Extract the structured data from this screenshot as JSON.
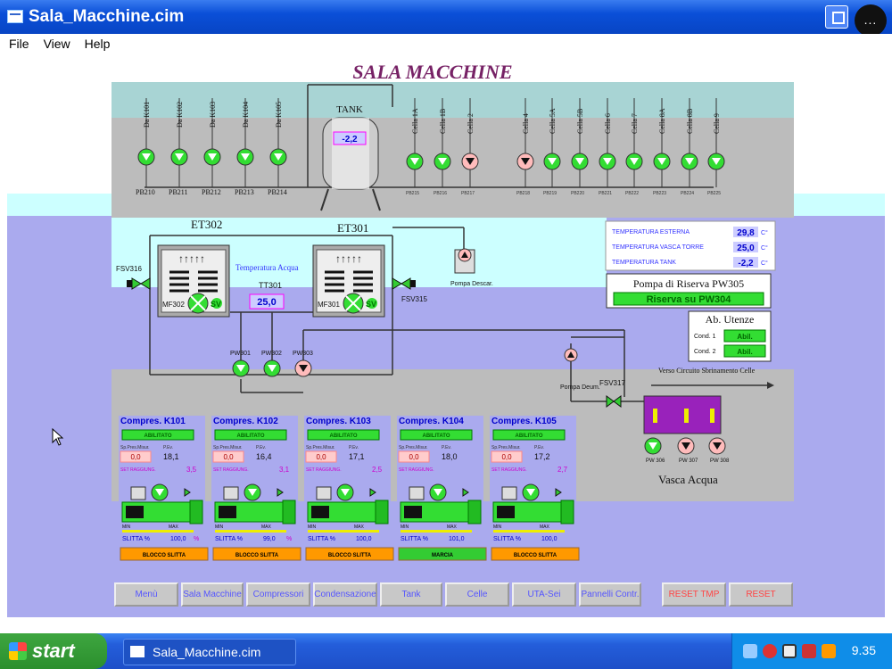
{
  "window": {
    "title": "Sala_Macchine.cim",
    "circle_btn": "..."
  },
  "menu": [
    "File",
    "View",
    "Help"
  ],
  "scada": {
    "title": "SALA MACCHINE",
    "tank": {
      "label": "TANK",
      "value": "-2,2"
    },
    "top_pumps": [
      {
        "label": "Da K101",
        "id": "PB210"
      },
      {
        "label": "Da K102",
        "id": "PB211"
      },
      {
        "label": "Da K103",
        "id": "PB212"
      },
      {
        "label": "Da K104",
        "id": "PB213"
      },
      {
        "label": "Da K105",
        "id": "PB214"
      }
    ],
    "cells": [
      {
        "label": "Cella 1A",
        "state": "on"
      },
      {
        "label": "Cella 1B",
        "state": "on"
      },
      {
        "label": "Cella 2",
        "state": "off"
      },
      {
        "label": "Cella 4",
        "state": "off"
      },
      {
        "label": "Cella 5A",
        "state": "on"
      },
      {
        "label": "Cella 5B",
        "state": "on"
      },
      {
        "label": "Cella 6",
        "state": "on"
      },
      {
        "label": "Cella 7",
        "state": "on"
      },
      {
        "label": "Cella 8A",
        "state": "on"
      },
      {
        "label": "Cella 8B",
        "state": "on"
      },
      {
        "label": "Cella 9",
        "state": "on"
      }
    ],
    "cell_ids": [
      "PB215",
      "PB216",
      "PB217",
      "PB218",
      "PB219",
      "PB220",
      "PB221",
      "PB222",
      "PB223",
      "PB224",
      "PB225"
    ],
    "et302": "ET302",
    "et301": "ET301",
    "mf302": "MF302",
    "mf301": "MF301",
    "sv": "SV",
    "fsv316": "FSV316",
    "fsv315": "FSV315",
    "fsv317": "FSV317",
    "temp_acqua_label": "Temperatura Acqua",
    "tt301": "TT301",
    "tt301_value": "25,0",
    "pompa_descar": "Pompa Descar.",
    "pompa_deum": "Pompa Deum.",
    "pw_pumps": [
      "PW301",
      "PW302",
      "PW303"
    ],
    "temps": [
      {
        "label": "TEMPERATURA ESTERNA",
        "value": "29,8",
        "unit": "C°"
      },
      {
        "label": "TEMPERATURA VASCA TORRE",
        "value": "25,0",
        "unit": "C°"
      },
      {
        "label": "TEMPERATURA TANK",
        "value": "-2,2",
        "unit": "C°"
      }
    ],
    "pompa_riserva": {
      "title": "Pompa di Riserva PW305",
      "button": "Riserva su PW304"
    },
    "ab_utenze": {
      "title": "Ab. Utenze",
      "rows": [
        {
          "label": "Cond. 1",
          "button": "Abil."
        },
        {
          "label": "Cond. 2",
          "button": "Abil."
        }
      ]
    },
    "verso_text": "Verso Circuito Sbrinamento Celle",
    "vasca": {
      "label": "Vasca Acqua",
      "pumps": [
        "PW 306",
        "PW 307",
        "PW 308"
      ]
    },
    "compressors": [
      {
        "title": "Compres. K101",
        "abil": "ABILITATO",
        "v1": "0,0",
        "v2": "18,1",
        "v3": "3,5",
        "slitta": "100,0",
        "unit": "%",
        "status": "BLOCCO SLITTA",
        "status_color": "#ff9900",
        "s_label": "SLITTA %"
      },
      {
        "title": "Compres. K102",
        "abil": "ABILITATO",
        "v1": "0,0",
        "v2": "16,4",
        "v3": "3,1",
        "slitta": "99,0",
        "unit": "%",
        "status": "BLOCCO SLITTA",
        "status_color": "#ff9900",
        "s_label": "SLITTA %"
      },
      {
        "title": "Compres. K103",
        "abil": "ABILITATO",
        "v1": "0,0",
        "v2": "17,1",
        "v3": "2,5",
        "slitta": "100,0",
        "unit": "",
        "status": "BLOCCO SLITTA",
        "status_color": "#ff9900",
        "s_label": "SLITTA %"
      },
      {
        "title": "Compres. K104",
        "abil": "ABILITATO",
        "v1": "0,0",
        "v2": "18,0",
        "v3": "",
        "slitta": "101,0",
        "unit": "",
        "status": "MARCIA",
        "status_color": "#33cc33",
        "s_label": "SLITTA %"
      },
      {
        "title": "Compres. K105",
        "abil": "ABILITATO",
        "v1": "0,0",
        "v2": "17,2",
        "v3": "2,7",
        "slitta": "100,0",
        "unit": "",
        "status": "BLOCCO SLITTA",
        "status_color": "#ff9900",
        "s_label": "SLITTA %"
      }
    ],
    "comp_minmax": [
      "MIN",
      "MAX"
    ],
    "comp_labels": {
      "sp": "Sp.Pres.Misur.",
      "ev": "P.Ev.",
      "set": "SET RAGGIUNG."
    }
  },
  "nav": [
    "Menù",
    "Sala Macchine",
    "Compressori",
    "Condensazione",
    "Tank",
    "Celle",
    "UTA-Sei",
    "Pannelli Contr.",
    "RESET TMP",
    "RESET"
  ],
  "taskbar": {
    "start": "start",
    "item": "Sala_Macchine.cim",
    "clock": "9.35"
  },
  "colors": {
    "scada_blue": "#aaaaee",
    "cyan": "#ccffff",
    "gray": "#bcbcbc",
    "green": "#33dd33",
    "purple": "#9922bb"
  }
}
